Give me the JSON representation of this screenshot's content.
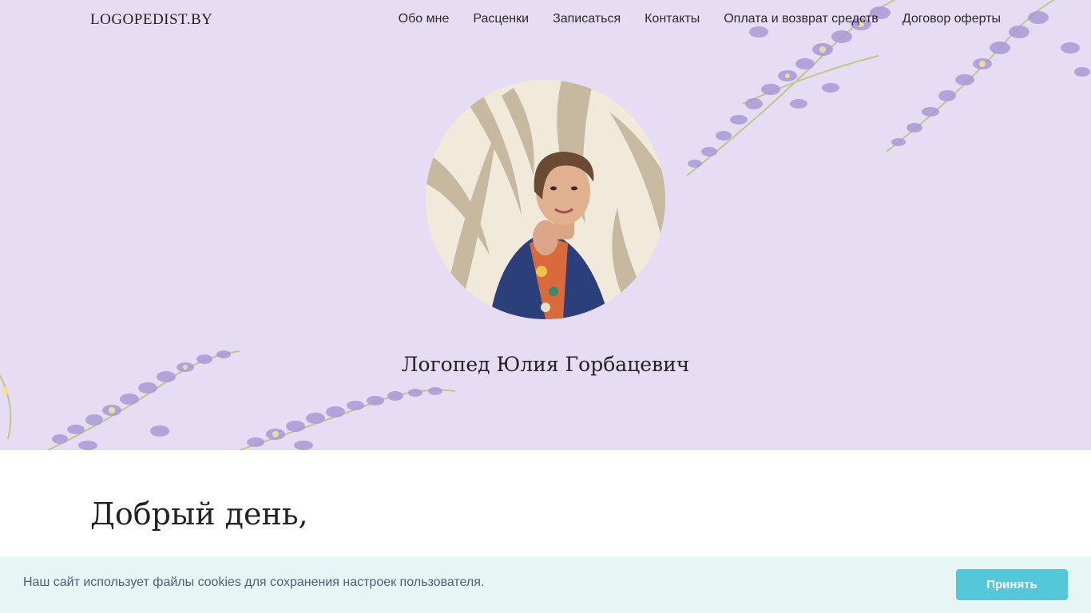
{
  "header": {
    "logo": "LOGOPEDIST.BY",
    "nav": [
      {
        "label": "Обо мне"
      },
      {
        "label": "Расценки"
      },
      {
        "label": "Записаться"
      },
      {
        "label": "Контакты"
      },
      {
        "label": "Оплата и возврат средств"
      },
      {
        "label": "Договор оферты"
      }
    ]
  },
  "hero": {
    "title": "Логопед Юлия Горбацевич",
    "background_color": "#e6ddf5"
  },
  "main": {
    "greeting": "Добрый день,"
  },
  "cookie_banner": {
    "text": "Наш сайт использует файлы cookies для сохранения настроек пользователя.",
    "accept_label": "Принять",
    "accent_color": "#54c8d9"
  }
}
